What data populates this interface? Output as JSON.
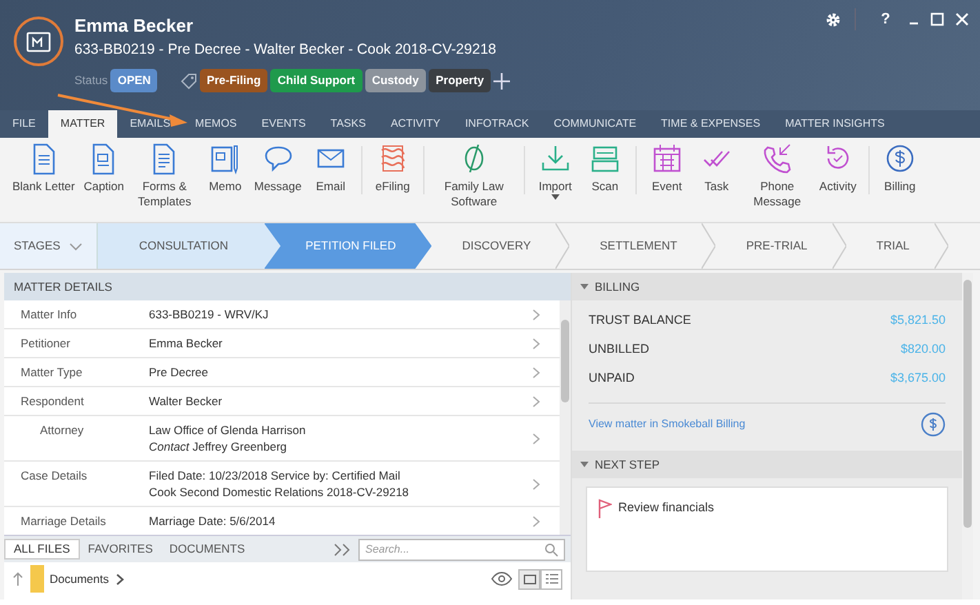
{
  "header": {
    "name": "Emma Becker",
    "subtitle": "633-BB0219 - Pre Decree - Walter Becker - Cook 2018-CV-29218",
    "status_label": "Status",
    "status": "OPEN",
    "tags": [
      {
        "label": "Pre-Filing",
        "color": "#9a5420"
      },
      {
        "label": "Child Support",
        "color": "#1f9a4c"
      },
      {
        "label": "Custody",
        "color": "#8c939c"
      },
      {
        "label": "Property",
        "color": "#3b3f44"
      }
    ],
    "window_controls": [
      "?"
    ]
  },
  "tabs": [
    {
      "label": "FILE",
      "selected": false
    },
    {
      "label": "MATTER",
      "selected": true
    },
    {
      "label": "EMAILS",
      "selected": false
    },
    {
      "label": "MEMOS",
      "selected": false
    },
    {
      "label": "EVENTS",
      "selected": false
    },
    {
      "label": "TASKS",
      "selected": false
    },
    {
      "label": "ACTIVITY",
      "selected": false
    },
    {
      "label": "INFOTRACK",
      "selected": false
    },
    {
      "label": "COMMUNICATE",
      "selected": false
    },
    {
      "label": "TIME & EXPENSES",
      "selected": false
    },
    {
      "label": "MATTER INSIGHTS",
      "selected": false
    }
  ],
  "ribbon": [
    {
      "label": "Blank Letter",
      "color": "#3a7bd5"
    },
    {
      "label": "Caption",
      "color": "#3a7bd5"
    },
    {
      "label": "Forms & Templates",
      "color": "#3a7bd5"
    },
    {
      "label": "Memo",
      "color": "#3a7bd5"
    },
    {
      "label": "Message",
      "color": "#3a7bd5"
    },
    {
      "label": "Email",
      "color": "#3a7bd5"
    },
    {
      "label": "eFiling",
      "color": "#e8705a"
    },
    {
      "label": "Family Law Software",
      "color": "#2a9a6a"
    },
    {
      "label": "Import",
      "color": "#2ab08a"
    },
    {
      "label": "Scan",
      "color": "#2ab08a"
    },
    {
      "label": "Event",
      "color": "#c050d0"
    },
    {
      "label": "Task",
      "color": "#c050d0"
    },
    {
      "label": "Phone Message",
      "color": "#c050d0"
    },
    {
      "label": "Activity",
      "color": "#c050d0"
    },
    {
      "label": "Billing",
      "color": "#3a6cc0"
    }
  ],
  "stages_label": "STAGES",
  "stages": [
    {
      "label": "CONSULTATION",
      "completed": true,
      "selected": false
    },
    {
      "label": "PETITION FILED",
      "completed": false,
      "selected": true
    },
    {
      "label": "DISCOVERY",
      "completed": false,
      "selected": false
    },
    {
      "label": "SETTLEMENT",
      "completed": false,
      "selected": false
    },
    {
      "label": "PRE-TRIAL",
      "completed": false,
      "selected": false
    },
    {
      "label": "TRIAL",
      "completed": false,
      "selected": false
    }
  ],
  "matter_details": {
    "title": "MATTER DETAILS",
    "rows": [
      {
        "label": "Matter Info",
        "lines": [
          "633-BB0219 - WRV/KJ"
        ],
        "indented": false
      },
      {
        "label": "Petitioner",
        "lines": [
          "Emma Becker"
        ],
        "indented": false
      },
      {
        "label": "Matter Type",
        "lines": [
          "Pre Decree"
        ],
        "indented": false
      },
      {
        "label": "Respondent",
        "lines": [
          "Walter Becker"
        ],
        "indented": false
      },
      {
        "label": "Attorney",
        "lines": [
          "Law Office of Glenda Harrison",
          "*Contact* Jeffrey Greenberg"
        ],
        "indented": true
      },
      {
        "label": "Case Details",
        "lines": [
          "Filed Date: 10/23/2018  Service by: Certified Mail",
          "Cook Second Domestic Relations 2018-CV-29218"
        ],
        "indented": false
      },
      {
        "label": "Marriage Details",
        "lines": [
          "Marriage Date: 5/6/2014"
        ],
        "indented": false
      }
    ]
  },
  "files": {
    "tabs": [
      {
        "label": "ALL FILES",
        "selected": true
      },
      {
        "label": "FAVORITES",
        "selected": false
      },
      {
        "label": "DOCUMENTS",
        "selected": false
      }
    ],
    "search": {
      "placeholder": "Search..."
    },
    "breadcrumb": "Documents",
    "folder_view_selected": true
  },
  "billing": {
    "title": "BILLING",
    "rows": [
      {
        "label": "TRUST BALANCE",
        "value": "$5,821.50"
      },
      {
        "label": "UNBILLED",
        "value": "$820.00"
      },
      {
        "label": "UNPAID",
        "value": "$3,675.00"
      }
    ],
    "link": "View matter in Smokeball Billing"
  },
  "next_step": {
    "title": "NEXT STEP",
    "text": "Review financials"
  }
}
